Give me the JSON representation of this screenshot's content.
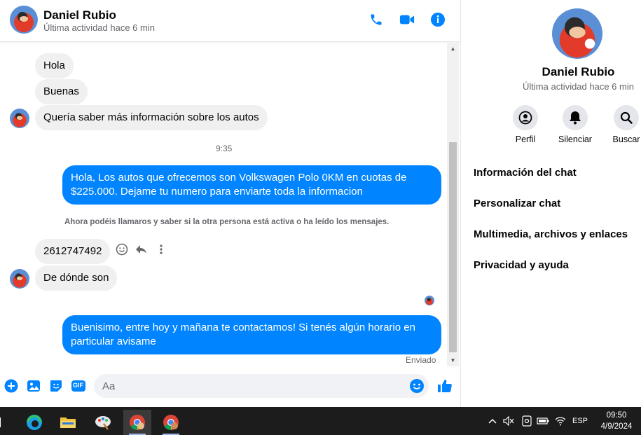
{
  "colors": {
    "accent": "#0084ff",
    "bubble_in": "#f0f0f0",
    "taskbar": "#1c1c1c"
  },
  "contact": {
    "name": "Daniel Rubio",
    "status": "Última actividad hace 6 min"
  },
  "header_actions": [
    "phone-icon",
    "video-camera-icon",
    "info-icon"
  ],
  "messages": {
    "m1": "Hola",
    "m2": "Buenas",
    "m3": "Quería saber más información sobre los autos",
    "time": "9:35",
    "m4": "Hola, Los autos que ofrecemos son Volkswagen Polo 0KM en cuotas de $225.000. Dejame tu numero para enviarte toda la informacion",
    "system_note": "Ahora podéis llamaros y saber si la otra persona está activa o ha leído los mensajes.",
    "m5": "2612747492",
    "m6": "De dónde son",
    "m7": "Buenisimo, entre hoy y mañana te contactamos! Si tenés algún horario en particular avisame",
    "delivery_status": "Enviado"
  },
  "message_actions": [
    "smile-icon",
    "reply-icon",
    "more-icon"
  ],
  "composer": {
    "placeholder": "Aa",
    "buttons": [
      "plus-icon",
      "image-icon",
      "sticker-icon",
      "gif-icon"
    ],
    "gif_label": "GIF"
  },
  "info_panel": {
    "name": "Daniel Rubio",
    "status": "Última actividad hace 6 min",
    "actions": [
      {
        "label": "Perfil",
        "icon": "profile-icon"
      },
      {
        "label": "Silenciar",
        "icon": "bell-icon"
      },
      {
        "label": "Buscar",
        "icon": "search-icon"
      }
    ],
    "links": [
      "Información del chat",
      "Personalizar chat",
      "Multimedia, archivos y enlaces",
      "Privacidad y ayuda"
    ]
  },
  "taskbar": {
    "language": "ESP",
    "time": "09:50",
    "date": "4/9/2024"
  }
}
